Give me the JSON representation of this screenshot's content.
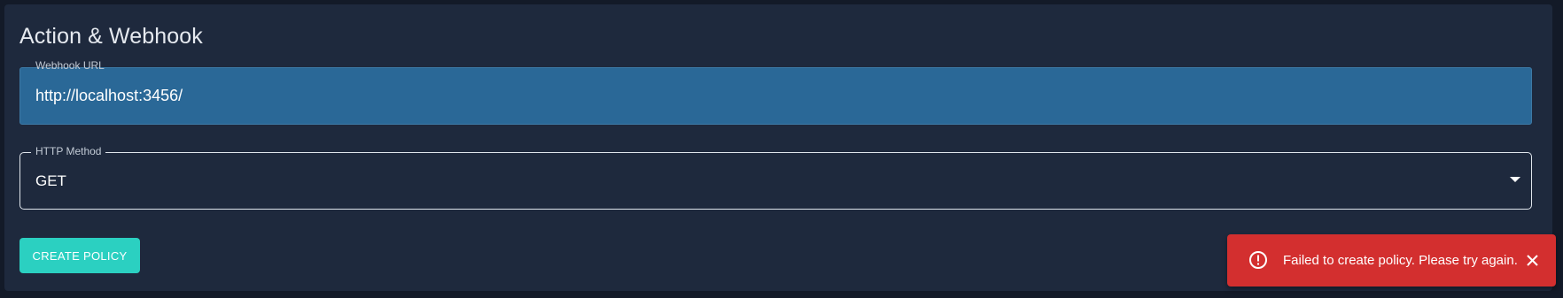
{
  "section": {
    "title": "Action & Webhook"
  },
  "webhook_url": {
    "label": "Webhook URL",
    "value": "http://localhost:3456/"
  },
  "http_method": {
    "label": "HTTP Method",
    "value": "GET"
  },
  "actions": {
    "create_label": "CREATE POLICY"
  },
  "toast": {
    "message": "Failed to create policy. Please try again.",
    "icon": "error-outline-icon",
    "close_icon": "close-icon",
    "background": "#d32f2f"
  },
  "colors": {
    "background": "#131a28",
    "panel": "#1e293d",
    "url_field_fill": "#2a6897",
    "accent_button": "#2bd0c1"
  }
}
